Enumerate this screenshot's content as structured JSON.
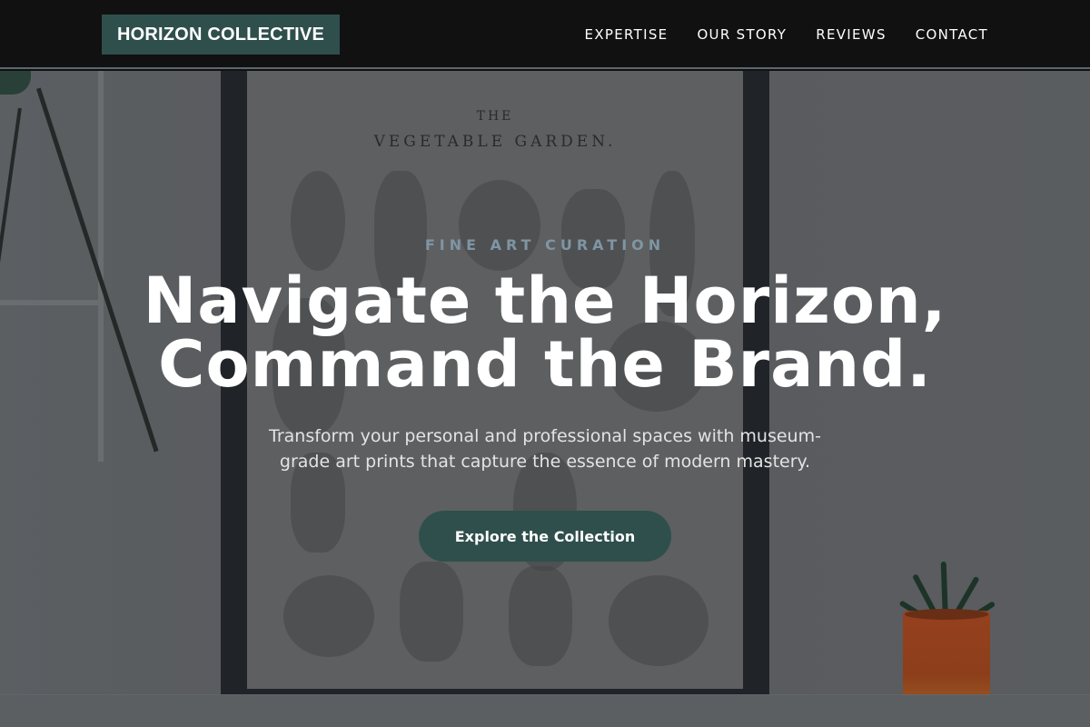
{
  "header": {
    "logo": "HORIZON COLLECTIVE",
    "nav": [
      "EXPERTISE",
      "OUR STORY",
      "REVIEWS",
      "CONTACT"
    ]
  },
  "hero": {
    "poster_title_small": "THE",
    "poster_title": "VEGETABLE GARDEN.",
    "eyebrow": "FINE ART CURATION",
    "headline_line1": "Navigate the Horizon,",
    "headline_line2": "Command the Brand.",
    "subtext": "Transform your personal and professional spaces with museum-grade art prints that capture the essence of modern mastery.",
    "cta_label": "Explore the Collection"
  },
  "colors": {
    "header_bg": "#111111",
    "accent": "#2f4f4c",
    "eyebrow": "#7f95a4"
  }
}
